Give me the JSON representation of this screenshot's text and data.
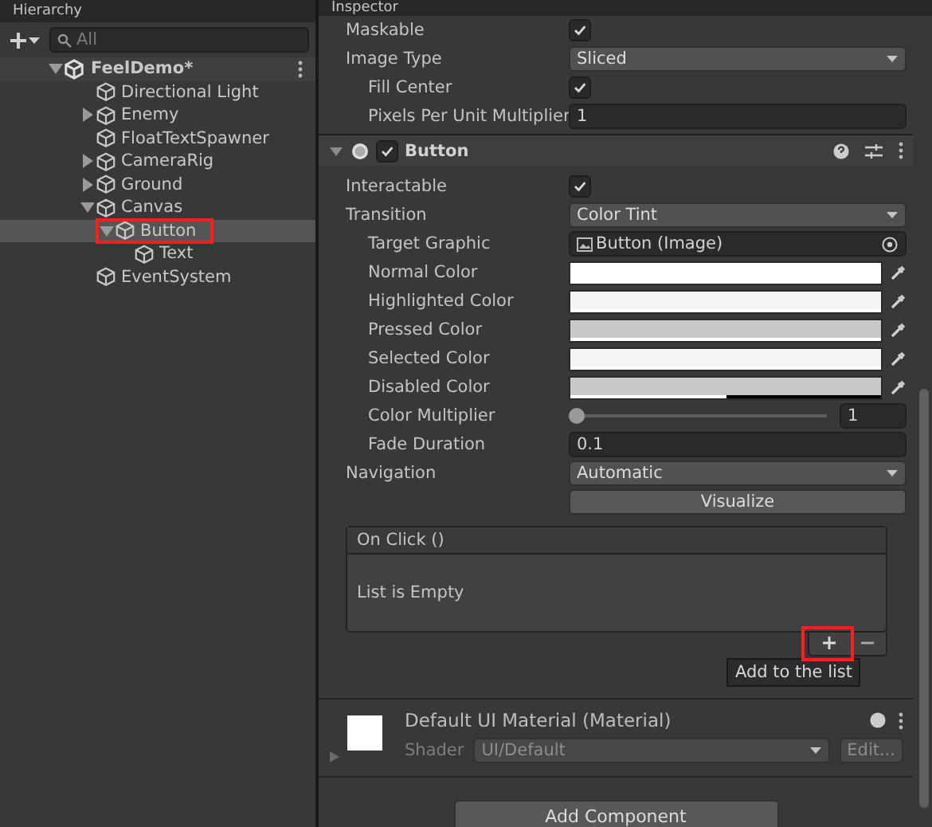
{
  "hierarchy": {
    "title": "Hierarchy",
    "search": {
      "placeholder": "All"
    },
    "tree": [
      {
        "label": "FeelDemo*",
        "kind": "scene",
        "expanded": true,
        "selected": false,
        "highlighted": false,
        "children": [
          {
            "label": "Directional Light",
            "kind": "object",
            "selected": false,
            "highlighted": false
          },
          {
            "label": "Enemy",
            "kind": "object",
            "expanded": false,
            "selected": false,
            "highlighted": false
          },
          {
            "label": "FloatTextSpawner",
            "kind": "object",
            "selected": false,
            "highlighted": false
          },
          {
            "label": "CameraRig",
            "kind": "object",
            "expanded": false,
            "selected": false,
            "highlighted": false
          },
          {
            "label": "Ground",
            "kind": "object",
            "expanded": false,
            "selected": false,
            "highlighted": false
          },
          {
            "label": "Canvas",
            "kind": "object",
            "expanded": true,
            "selected": false,
            "highlighted": false,
            "children": [
              {
                "label": "Button",
                "kind": "object",
                "expanded": true,
                "selected": true,
                "highlighted": true,
                "children": [
                  {
                    "label": "Text",
                    "kind": "object",
                    "selected": false,
                    "highlighted": false
                  }
                ]
              }
            ]
          },
          {
            "label": "EventSystem",
            "kind": "object",
            "selected": false,
            "highlighted": false
          }
        ]
      }
    ]
  },
  "inspector": {
    "title": "Inspector",
    "image_properties": [
      {
        "label": "Maskable",
        "kind": "checkbox",
        "checked": true
      },
      {
        "label": "Image Type",
        "kind": "dropdown",
        "value": "Sliced",
        "children": [
          {
            "label": "Fill Center",
            "kind": "checkbox",
            "checked": true
          },
          {
            "label": "Pixels Per Unit Multiplier",
            "kind": "number",
            "value": "1"
          }
        ]
      }
    ],
    "component": {
      "title": "Button",
      "enabled": true,
      "expanded": true,
      "properties": [
        {
          "label": "Interactable",
          "kind": "checkbox",
          "checked": true
        },
        {
          "label": "Transition",
          "kind": "dropdown",
          "value": "Color Tint",
          "children": [
            {
              "label": "Target Graphic",
              "kind": "object",
              "value": "Button (Image)"
            },
            {
              "label": "Normal Color",
              "kind": "color",
              "color": "#ffffff",
              "level": 1
            },
            {
              "label": "Highlighted Color",
              "kind": "color",
              "color": "#f5f5f5",
              "level": 1
            },
            {
              "label": "Pressed Color",
              "kind": "color",
              "color": "#c8c8c8",
              "level": 1
            },
            {
              "label": "Selected Color",
              "kind": "color",
              "color": "#f5f5f5",
              "level": 1
            },
            {
              "label": "Disabled Color",
              "kind": "color",
              "color": "#c8c8c8",
              "level": 0.5
            },
            {
              "label": "Color Multiplier",
              "kind": "slider",
              "level": 0,
              "value": "1"
            },
            {
              "label": "Fade Duration",
              "kind": "number",
              "value": "0.1"
            }
          ]
        },
        {
          "label": "Navigation",
          "kind": "dropdown",
          "value": "Automatic"
        },
        {
          "label": "Visualize",
          "kind": "button"
        }
      ]
    },
    "on_click": {
      "title": "On Click ()",
      "empty_text": "List is Empty",
      "add_highlighted": true,
      "tooltip": "Add to the list"
    },
    "material": {
      "name": "Default UI Material (Material)",
      "shader_label": "Shader",
      "shader": "UI/Default",
      "edit": "Edit..."
    },
    "add_component": "Add Component"
  }
}
